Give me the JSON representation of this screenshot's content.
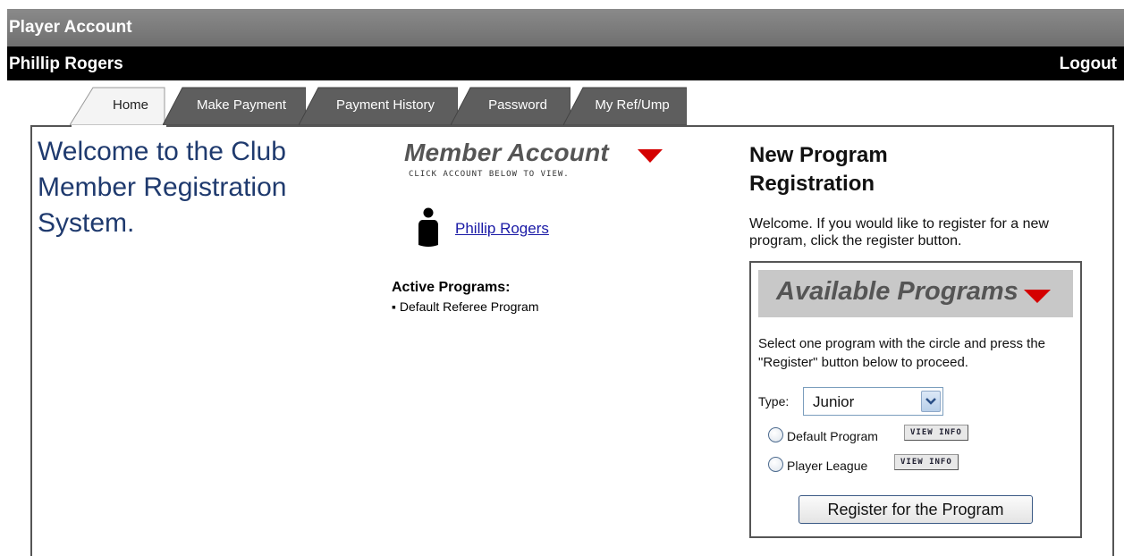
{
  "header": {
    "title": "Player Account"
  },
  "userbar": {
    "name": "Phillip Rogers",
    "logout": "Logout"
  },
  "tabs": [
    {
      "label": "Home",
      "active": true
    },
    {
      "label": "Make Payment"
    },
    {
      "label": "Payment History"
    },
    {
      "label": "Password"
    },
    {
      "label": "My Ref/Ump"
    }
  ],
  "welcome": {
    "text": "Welcome to the Club Member Registration System."
  },
  "member_account": {
    "title": "Member Account",
    "subtitle": "CLICK ACCOUNT BELOW TO VIEW.",
    "member_name": "Phillip Rogers",
    "active_programs_label": "Active Programs:",
    "active_programs": [
      "▪ Default Referee Program"
    ]
  },
  "new_program": {
    "title": "New Program Registration",
    "description": "Welcome. If you would like to register for a new program, click the register button.",
    "available_title": "Available Programs",
    "instructions": "Select one program with the circle and press the \"Register\" button below to proceed.",
    "type_label": "Type:",
    "type_value": "Junior",
    "programs": [
      {
        "name": "Default Program",
        "button": "VIEW INFO"
      },
      {
        "name": "Player League",
        "button": "VIEW INFO"
      }
    ],
    "register_button": "Register for the Program"
  },
  "colors": {
    "accent_red": "#d40000",
    "heading_blue": "#1f3a6e",
    "tab_dark": "#5e5e5e"
  },
  "icons": {
    "member": "person-icon",
    "dropdown": "chevron-down-icon",
    "section": "triangle-down-icon"
  }
}
